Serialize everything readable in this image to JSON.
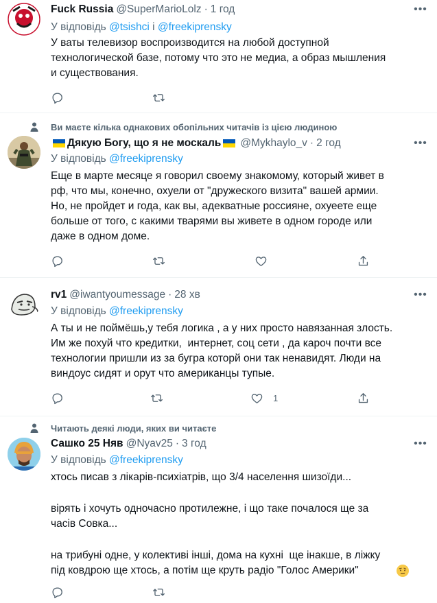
{
  "tweets": [
    {
      "name": "Fuck Russia",
      "handle": "@SuperMarioLolz",
      "time": "1 год",
      "reply_prefix": "У відповідь ",
      "reply_mention_1": "@tsishci",
      "reply_joiner": " і ",
      "reply_mention_2": "@freekiprensky",
      "text": "У ваты телевизор воспроизводится на любой доступной\nтехнологической базе, потому что это не медиа, а образ мышления\nи существования."
    },
    {
      "social": "Ви маєте кілька однакових обопільних читачів із цією людиною",
      "name": "Дякую Богу, що я не москаль",
      "handle": "@Mykhaylo_v",
      "time": "2 год",
      "reply_prefix": "У відповідь ",
      "reply_mention_1": "@freekiprensky",
      "text": "Еще в марте месяце я говорил своему знакомому, который живет в\nрф, что мы, конечно, охуели от \"дружеского визита\" вашей армии.\nНо, не пройдет и года, как вы, адекватные россияне, охуеете еще\nбольше от того, с какими тварями вы живете в одном городе или\nдаже в одном доме."
    },
    {
      "name": "rv1",
      "handle": "@iwantyoumessage",
      "time": "28 хв",
      "reply_prefix": "У відповідь ",
      "reply_mention_1": "@freekiprensky",
      "text": "А ты и не поймёшь,у тебя логика , а у них просто навязанная злость.\nИм же похуй что кредитки,  интернет, соц сети , да кароч почти все\nтехнологии пришли из за бугра которй они так ненавидят. Люди на\nвиндоус сидят и орут что американцы тупые.",
      "like_count": "1"
    },
    {
      "social": "Читають деякі люди, яких ви читаєте",
      "name": "Сашко 25 Няв",
      "handle": "@Nyav25",
      "time": "3 год",
      "reply_prefix": "У відповідь ",
      "reply_mention_1": "@freekiprensky",
      "text_1": "хтось писав з лікарів-психіатрів, що 3/4 населення шизоїди...",
      "text_2": "вірять і хочуть одночасно протилежне, і що таке почалося ще за\nчасів Совка...",
      "text_3": "на трибуні одне, у колективі інші, дома на кухні  ще інакше, в ліжку\nпід ковдрою ще хтось, а потім ще круть радіо \"Голос Америки\""
    }
  ],
  "separator": "·",
  "icons": [
    "reply-icon",
    "retweet-icon",
    "like-icon",
    "share-icon",
    "more-icon",
    "person-icon",
    "ukraine-flag-icon",
    "raised-eyebrow-emoji"
  ],
  "colors": {
    "accent": "#1d9bf0",
    "muted": "#536471",
    "text": "#0f1419",
    "divider": "#eff3f4"
  }
}
